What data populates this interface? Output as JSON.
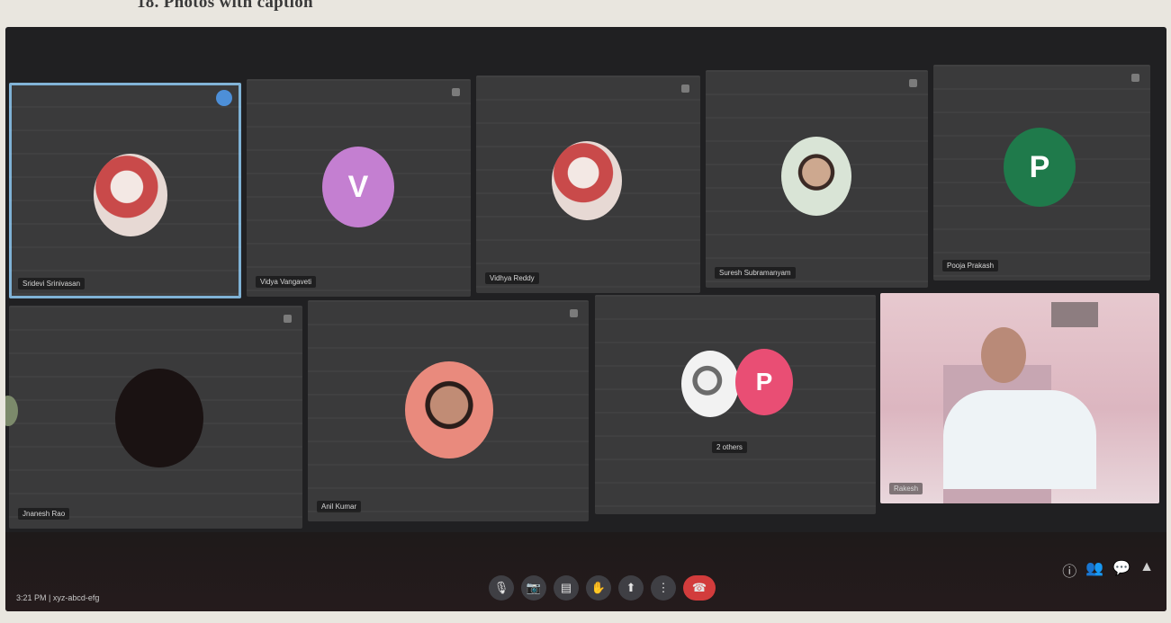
{
  "caption": "18. Photos with caption",
  "tiles": [
    {
      "name": "Sridevi Srinivasan",
      "initial": ""
    },
    {
      "name": "Vidya Vangaveti",
      "initial": "V"
    },
    {
      "name": "Vidhya Reddy",
      "initial": ""
    },
    {
      "name": "Suresh Subramanyam",
      "initial": ""
    },
    {
      "name": "Pooja Prakash",
      "initial": "P"
    },
    {
      "name": "Jnanesh Rao",
      "initial": ""
    },
    {
      "name": "Anil Kumar",
      "initial": ""
    },
    {
      "name": "2 others",
      "initial": "P"
    },
    {
      "name": "Rakesh",
      "initial": ""
    }
  ],
  "toolbar": {
    "meeting_info": "3:21 PM | xyz-abcd-efg",
    "controls": [
      "mic-icon",
      "camera-icon",
      "captions-icon",
      "raise-hand-icon",
      "present-icon",
      "more-icon",
      "end-call-icon"
    ],
    "right_icons": [
      "info-icon",
      "people-icon",
      "chat-icon",
      "activities-icon"
    ]
  },
  "colors": {
    "tile_bg": "#3a3a3b",
    "avatar_purple": "#c47fd1",
    "avatar_green": "#1f7a4b",
    "avatar_pink": "#e94e74",
    "end_call": "#d23c3c",
    "active_border": "#7fb2d6"
  }
}
